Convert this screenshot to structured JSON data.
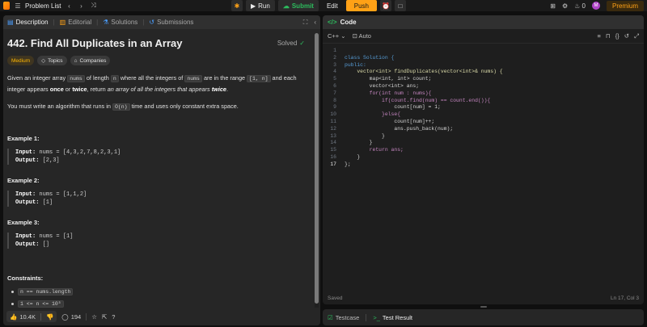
{
  "topbar": {
    "problem_list": "Problem List",
    "run": "Run",
    "submit": "Submit",
    "edit": "Edit",
    "push": "Push",
    "coins": "0",
    "avatar_letter": "M",
    "premium": "Premium"
  },
  "left": {
    "tabs": [
      "Description",
      "Editorial",
      "Solutions",
      "Submissions"
    ],
    "title": "442. Find All Duplicates in an Array",
    "solved": "Solved",
    "tags": [
      "Medium",
      "Topics",
      "Companies"
    ],
    "desc": {
      "p1a": "Given an integer array ",
      "code_nums": "nums",
      "p1b": " of length ",
      "code_n": "n",
      "p1c": " where all the integers of ",
      "p1d": " are in the range ",
      "code_range": "[1, n]",
      "p1e": " and each integer appears ",
      "once": "once",
      "or": " or ",
      "twice": "twice",
      "p1f": ", return ",
      "italic_a": "an array of all the integers that appears ",
      "twice_b": "twice",
      "dot": ".",
      "p2a": "You must write an algorithm that runs in ",
      "code_on": "O(n)",
      "p2b": " time and uses only constant extra space."
    },
    "examples": [
      {
        "title": "Example 1:",
        "input_label": "Input:",
        "input": "nums = [4,3,2,7,8,2,3,1]",
        "output_label": "Output:",
        "output": "[2,3]"
      },
      {
        "title": "Example 2:",
        "input_label": "Input:",
        "input": "nums = [1,1,2]",
        "output_label": "Output:",
        "output": "[1]"
      },
      {
        "title": "Example 3:",
        "input_label": "Input:",
        "input": "nums = [1]",
        "output_label": "Output:",
        "output": "[]"
      }
    ],
    "constraints_title": "Constraints:",
    "constraints": [
      "n == nums.length",
      "1 <= n <= 10⁵"
    ],
    "footer": {
      "likes": "10.4K",
      "comments": "194"
    }
  },
  "code": {
    "header": "Code",
    "language": "C++",
    "mode": "Auto",
    "lines": [
      {
        "n": "1",
        "t": ""
      },
      {
        "n": "2",
        "t": "class Solution {"
      },
      {
        "n": "3",
        "t": "public:"
      },
      {
        "n": "4",
        "t": "    vector<int> findDuplicates(vector<int>& nums) {"
      },
      {
        "n": "5",
        "t": "        map<int, int> count;"
      },
      {
        "n": "6",
        "t": "        vector<int> ans;"
      },
      {
        "n": "7",
        "t": "        for(int num : nums){"
      },
      {
        "n": "8",
        "t": "            if(count.find(num) == count.end()){"
      },
      {
        "n": "9",
        "t": "                count[num] = 1;"
      },
      {
        "n": "10",
        "t": "            }else{"
      },
      {
        "n": "11",
        "t": "                count[num]++;"
      },
      {
        "n": "12",
        "t": "                ans.push_back(num);"
      },
      {
        "n": "13",
        "t": "            }"
      },
      {
        "n": "14",
        "t": "        }"
      },
      {
        "n": "15",
        "t": "        return ans;"
      },
      {
        "n": "16",
        "t": "    }"
      },
      {
        "n": "17",
        "t": "};"
      }
    ],
    "status": "Saved",
    "cursor_pos": "Ln 17, Col 3"
  },
  "test": {
    "testcase": "Testcase",
    "result": "Test Result"
  }
}
